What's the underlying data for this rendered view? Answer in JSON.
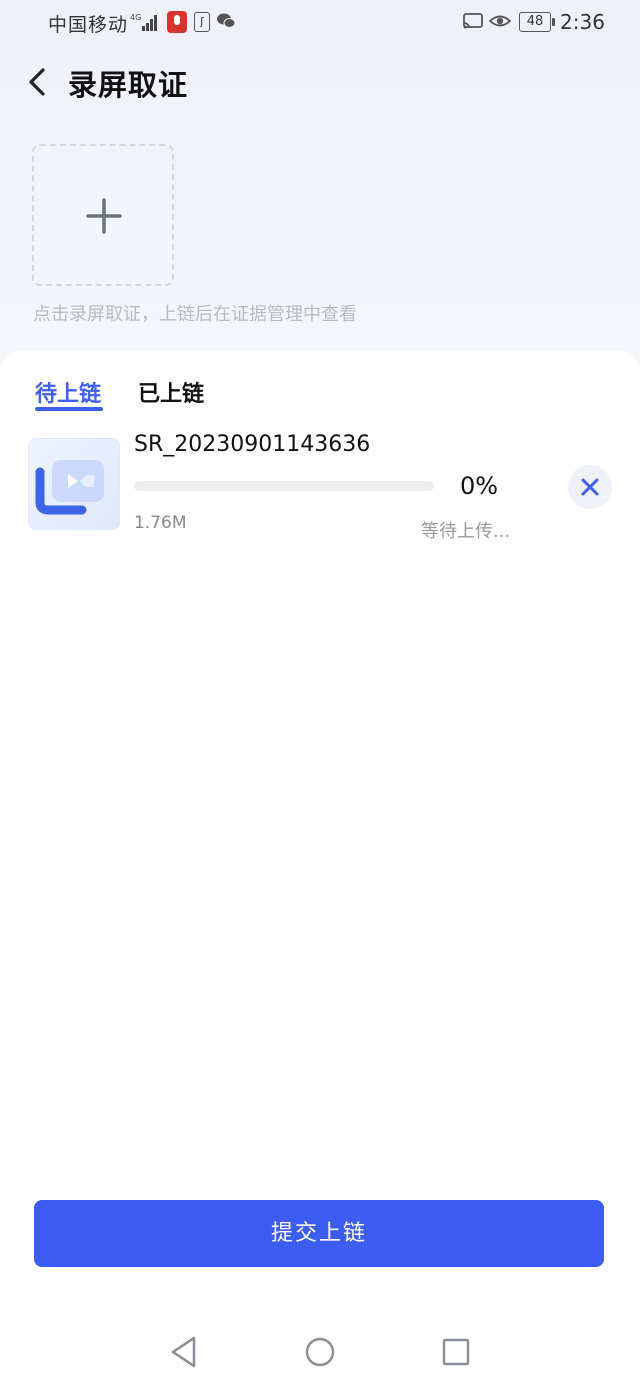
{
  "status_bar": {
    "carrier": "中国移动",
    "network": "4G",
    "battery": "48",
    "time": "2:36"
  },
  "header": {
    "title": "录屏取证"
  },
  "add_tile": {
    "hint": "点击录屏取证，上链后在证据管理中查看"
  },
  "tabs": [
    {
      "label": "待上链",
      "active": true
    },
    {
      "label": "已上链",
      "active": false
    }
  ],
  "files": [
    {
      "name": "SR_20230901143636",
      "size": "1.76M",
      "progress": 0,
      "progress_label": "0%",
      "status": "等待上传..."
    }
  ],
  "footer": {
    "submit_label": "提交上链"
  },
  "colors": {
    "accent": "#3f5ff0",
    "submit": "#3d5cf2"
  },
  "icons": [
    "back-arrow-icon",
    "plus-icon",
    "video-file-icon",
    "close-icon",
    "nav-back-icon",
    "nav-home-icon",
    "nav-recent-icon"
  ]
}
